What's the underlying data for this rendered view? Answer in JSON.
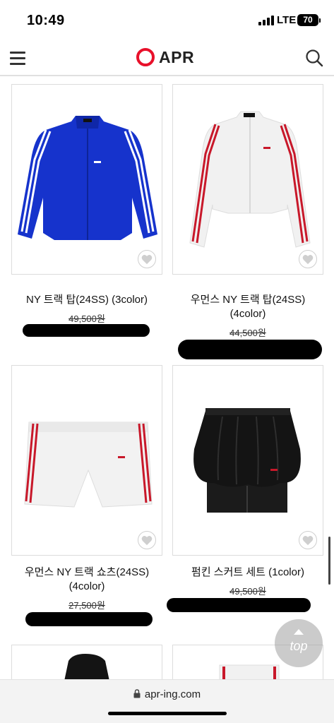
{
  "status_bar": {
    "time": "10:49",
    "network": "LTE",
    "battery": "70"
  },
  "header": {
    "logo_text": "APR"
  },
  "products": [
    {
      "name": "NY 트랙 탑(24SS) (3color)",
      "original_price": "49,500원"
    },
    {
      "name": "우먼스 NY 트랙 탑(24SS) (4color)",
      "original_price": "44,500원"
    },
    {
      "name": "우먼스 NY 트랙 쇼츠(24SS) (4color)",
      "original_price": "27,500원"
    },
    {
      "name": "펌킨 스커트 세트 (1color)",
      "original_price": "49,500원"
    }
  ],
  "top_button": {
    "label": "top"
  },
  "browser": {
    "url": "apr-ing.com"
  },
  "colors": {
    "brand_red": "#e8102a",
    "jacket_blue": "#1633cc",
    "stripe_red": "#c8182a"
  }
}
